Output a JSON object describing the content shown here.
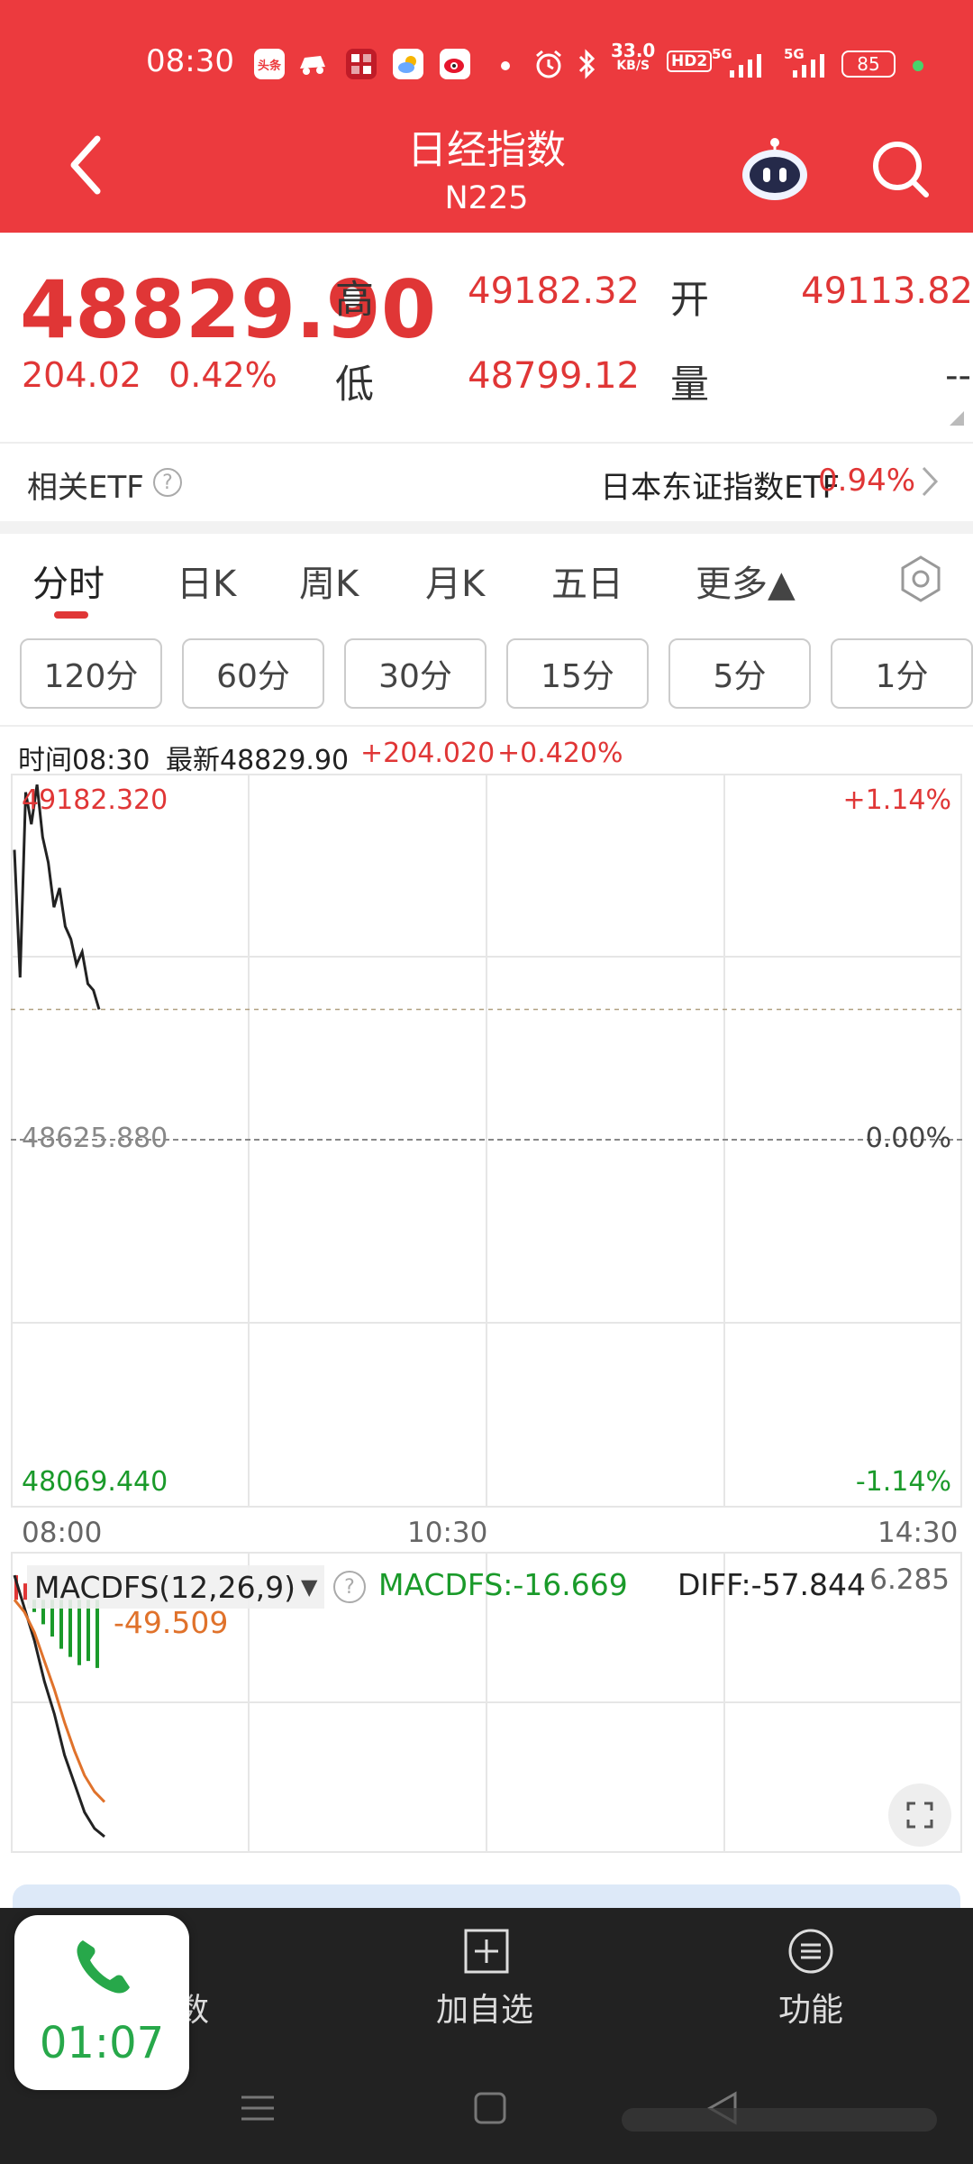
{
  "status_bar": {
    "time": "08:30",
    "app_icon_1": "头条",
    "net_speed_value": "33.0",
    "net_speed_unit": "KB/S",
    "hd_label": "HD2",
    "signal1": "5G",
    "signal2": "5G",
    "battery": "85",
    "icons": [
      "toutiao-icon",
      "car-icon",
      "game-icon",
      "weather-icon",
      "weibo-icon",
      "dot-icon",
      "alarm-icon",
      "bluetooth-icon",
      "wifi-signal-icon"
    ]
  },
  "header": {
    "title": "日经指数",
    "subtitle": "N225"
  },
  "quote": {
    "price": "48829.90",
    "change": "204.02",
    "change_pct": "0.42%",
    "high_label": "高",
    "high": "49182.32",
    "low_label": "低",
    "low": "48799.12",
    "open_label": "开",
    "open": "49113.82",
    "volume_label": "量",
    "volume": "--"
  },
  "etf": {
    "label": "相关ETF",
    "help": "?",
    "name": "日本东证指数ETF",
    "pct": "0.94%"
  },
  "tabs": [
    {
      "label": "分时"
    },
    {
      "label": "日K"
    },
    {
      "label": "周K"
    },
    {
      "label": "月K"
    },
    {
      "label": "五日"
    },
    {
      "label": "更多▲"
    }
  ],
  "periods": [
    {
      "label": "120分"
    },
    {
      "label": "60分"
    },
    {
      "label": "30分"
    },
    {
      "label": "15分"
    },
    {
      "label": "5分"
    },
    {
      "label": "1分"
    }
  ],
  "chart_info": {
    "time": "时间08:30",
    "latest": "最新48829.90",
    "change": "+204.020",
    "change_pct": "+0.420%"
  },
  "chart_data": {
    "type": "line",
    "price_axis": {
      "high": "49182.320",
      "mid": "48625.880",
      "low": "48069.440"
    },
    "pct_axis": {
      "high": "+1.14%",
      "mid": "0.00%",
      "low": "-1.14%"
    },
    "x_labels": [
      "08:00",
      "10:30",
      "14:30"
    ],
    "ylim": [
      48069.44,
      49182.32
    ],
    "prev_close": 48625.88,
    "current": 48829.9,
    "series": [
      {
        "values": [
          49080,
          48880,
          49170,
          49120,
          49182,
          49100,
          49060,
          48990,
          49020,
          48960,
          48940,
          48900,
          48920,
          48870,
          48860,
          48830
        ]
      }
    ],
    "colors": {
      "up": "#e03636",
      "down": "#1a9a2a",
      "line": "#222222",
      "grid": "#e6e6e6"
    }
  },
  "macd": {
    "indicator": "MACDFS(12,26,9)",
    "dropdown": "▼",
    "help": "?",
    "macdfs": "MACDFS:-16.669",
    "diff": "DIFF:-57.844",
    "dea": "-49.509",
    "top_value": "6.285",
    "chart_data": {
      "type": "line",
      "series": [
        {
          "values": [
            6,
            -2,
            -10,
            -20,
            -28,
            -38,
            -45,
            -52,
            -56,
            -58
          ]
        },
        {
          "values": [
            0,
            -3,
            -8,
            -15,
            -22,
            -30,
            -37,
            -43,
            -47,
            -49.5
          ]
        }
      ],
      "histogram": [
        6,
        4,
        -3,
        -6,
        -9,
        -12,
        -14,
        -16,
        -15,
        -16.7
      ]
    }
  },
  "bottom_nav": {
    "item1": "数",
    "item2": "加自选",
    "item3": "功能"
  },
  "call_widget": {
    "duration": "01:07"
  }
}
